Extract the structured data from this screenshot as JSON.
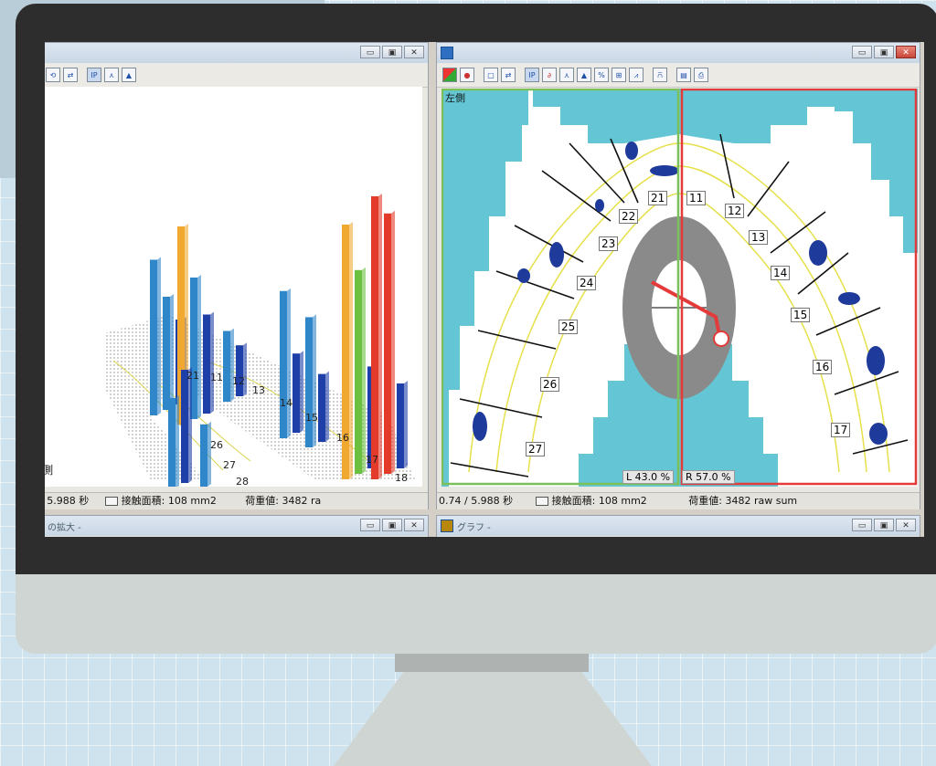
{
  "left_window": {
    "title": "",
    "toolbar_icons": [
      "rotate-icon",
      "swap-icon",
      "ip-icon",
      "peak-icon",
      "triangle-icon"
    ],
    "toolbar_labels": {
      "ip": "IP",
      "peak": "⋏",
      "tri": "▲"
    },
    "side_label": "側",
    "tooth_labels": [
      "21",
      "11",
      "12",
      "13",
      "14",
      "15",
      "16",
      "17",
      "18",
      "26",
      "27",
      "28"
    ],
    "status": {
      "time": "/ 5.988 秒",
      "area": "接触面積: 108 mm2",
      "load": "荷重値: 3482 ra"
    },
    "bars": [
      {
        "tooth": "21",
        "values": [
          0.55,
          0.4,
          0.3
        ]
      },
      {
        "tooth": "11",
        "values": [
          0.7,
          0.5,
          0.35
        ]
      },
      {
        "tooth": "13",
        "values": [
          0.25,
          0.18
        ]
      },
      {
        "tooth": "14",
        "values": [
          0.52,
          0.28
        ]
      },
      {
        "tooth": "15",
        "values": [
          0.46,
          0.24
        ]
      },
      {
        "tooth": "16",
        "values": [
          0.9,
          0.72,
          0.36
        ]
      },
      {
        "tooth": "17",
        "values": [
          1.0,
          0.92,
          0.3
        ]
      },
      {
        "tooth": "26",
        "values": [
          0.32,
          0.4
        ]
      },
      {
        "tooth": "27",
        "values": [
          0.22
        ]
      }
    ],
    "bar_colors": {
      "blue": "#1f3fa8",
      "light_blue": "#2f86c8",
      "orange": "#f0a830",
      "green": "#6cc040",
      "red": "#e33a2a"
    }
  },
  "right_window": {
    "title": "",
    "toolbar_icons": [
      "color-map-icon",
      "record-icon",
      "page-icon",
      "swap-icon",
      "ip-icon",
      "arch-icon",
      "peak-icon",
      "triangle-icon",
      "percent-icon",
      "grid-icon",
      "chart-icon",
      "dental-icon",
      "save-icon",
      "print-icon"
    ],
    "toolbar_labels": {
      "ip": "IP",
      "peak": "⋏",
      "tri": "▲",
      "percent": "%",
      "grid": "⊞"
    },
    "side_label": "左側",
    "left_tooth_labels": [
      "21",
      "22",
      "23",
      "24",
      "25",
      "26",
      "27"
    ],
    "right_tooth_labels": [
      "11",
      "12",
      "13",
      "14",
      "15",
      "16",
      "17"
    ],
    "balance": {
      "left": "L 43.0 %",
      "right": "R 57.0 %",
      "left_pct": 43.0,
      "right_pct": 57.0
    },
    "status": {
      "time": "0.74 / 5.988 秒",
      "area": "接触面積: 108 mm2",
      "load": "荷重値: 3482 raw sum"
    },
    "colors": {
      "background": "#64c6d4",
      "arch": "#ffffff",
      "contour": "#e6e04a",
      "contact": "#1e3a9a",
      "ring": "#8a8a8a",
      "left_frame": "#7cc05c",
      "right_frame": "#e33a3a"
    }
  },
  "bottom_left_window": {
    "title": "の拡大 -"
  },
  "bottom_right_window": {
    "title": "グラフ -"
  }
}
